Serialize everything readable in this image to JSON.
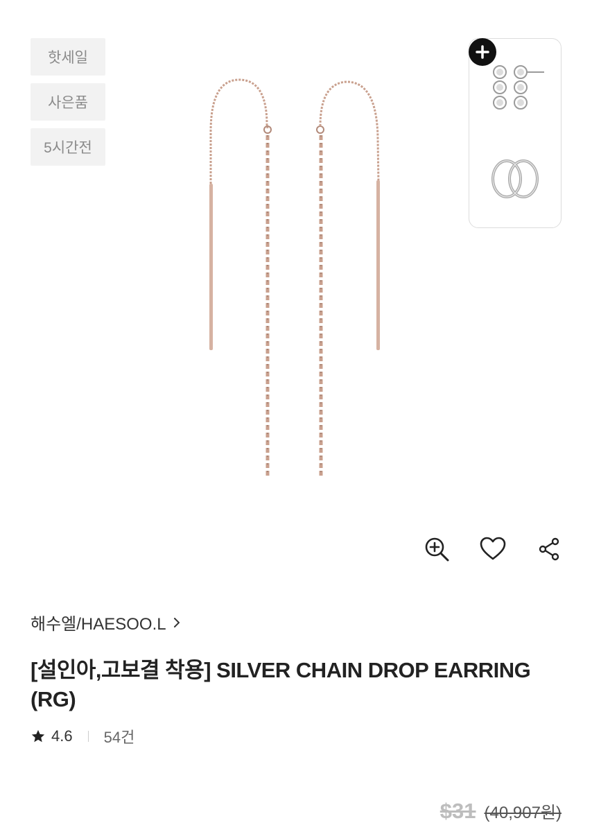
{
  "badges": [
    "핫세일",
    "사은품",
    "5시간전"
  ],
  "icons": {
    "zoom": "zoom-in-icon",
    "wishlist": "heart-icon",
    "share": "share-icon",
    "add": "plus-icon",
    "brand_link": "chevron-right-icon",
    "rating": "star-icon"
  },
  "product": {
    "brand": "해수엘/HAESOO.L",
    "title": "[설인아,고보결 착용] SILVER CHAIN DROP EARRING (RG)",
    "rating": "4.6",
    "review_count": "54건",
    "price_usd": "$31",
    "price_krw": "(40,907원)"
  },
  "colors": {
    "badge_bg": "#f2f2f2",
    "rose_gold": "#c9a08e",
    "text_primary": "#222222",
    "text_muted": "#bdbdbd"
  }
}
